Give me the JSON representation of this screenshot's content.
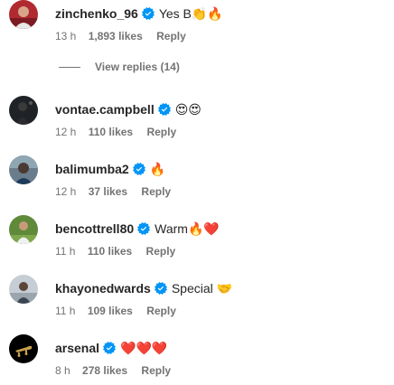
{
  "comments": [
    {
      "username": "zinchenko_96",
      "text": "Yes B👏🔥",
      "time": "13 h",
      "likes": "1,893 likes",
      "reply": "Reply",
      "avatar_icon": "user-avatar"
    },
    {
      "username": "vontae.campbell",
      "text": "😍😍",
      "time": "12 h",
      "likes": "110 likes",
      "reply": "Reply",
      "avatar_icon": "user-avatar"
    },
    {
      "username": "balimumba2",
      "text": "🔥",
      "time": "12 h",
      "likes": "37 likes",
      "reply": "Reply",
      "avatar_icon": "user-avatar"
    },
    {
      "username": "bencottrell80",
      "text": "Warm🔥❤️",
      "time": "11 h",
      "likes": "110 likes",
      "reply": "Reply",
      "avatar_icon": "user-avatar"
    },
    {
      "username": "khayonedwards",
      "text": "Special 🤝",
      "time": "11 h",
      "likes": "109 likes",
      "reply": "Reply",
      "avatar_icon": "user-avatar"
    },
    {
      "username": "arsenal",
      "text": "❤️❤️❤️",
      "time": "8 h",
      "likes": "278 likes",
      "reply": "Reply",
      "avatar_icon": "arsenal-logo"
    }
  ],
  "view_replies": "View replies (14)",
  "colors": {
    "verified": "#0095f6",
    "meta": "#737373",
    "text": "#262626"
  },
  "verified_icon": "verified-badge-icon"
}
